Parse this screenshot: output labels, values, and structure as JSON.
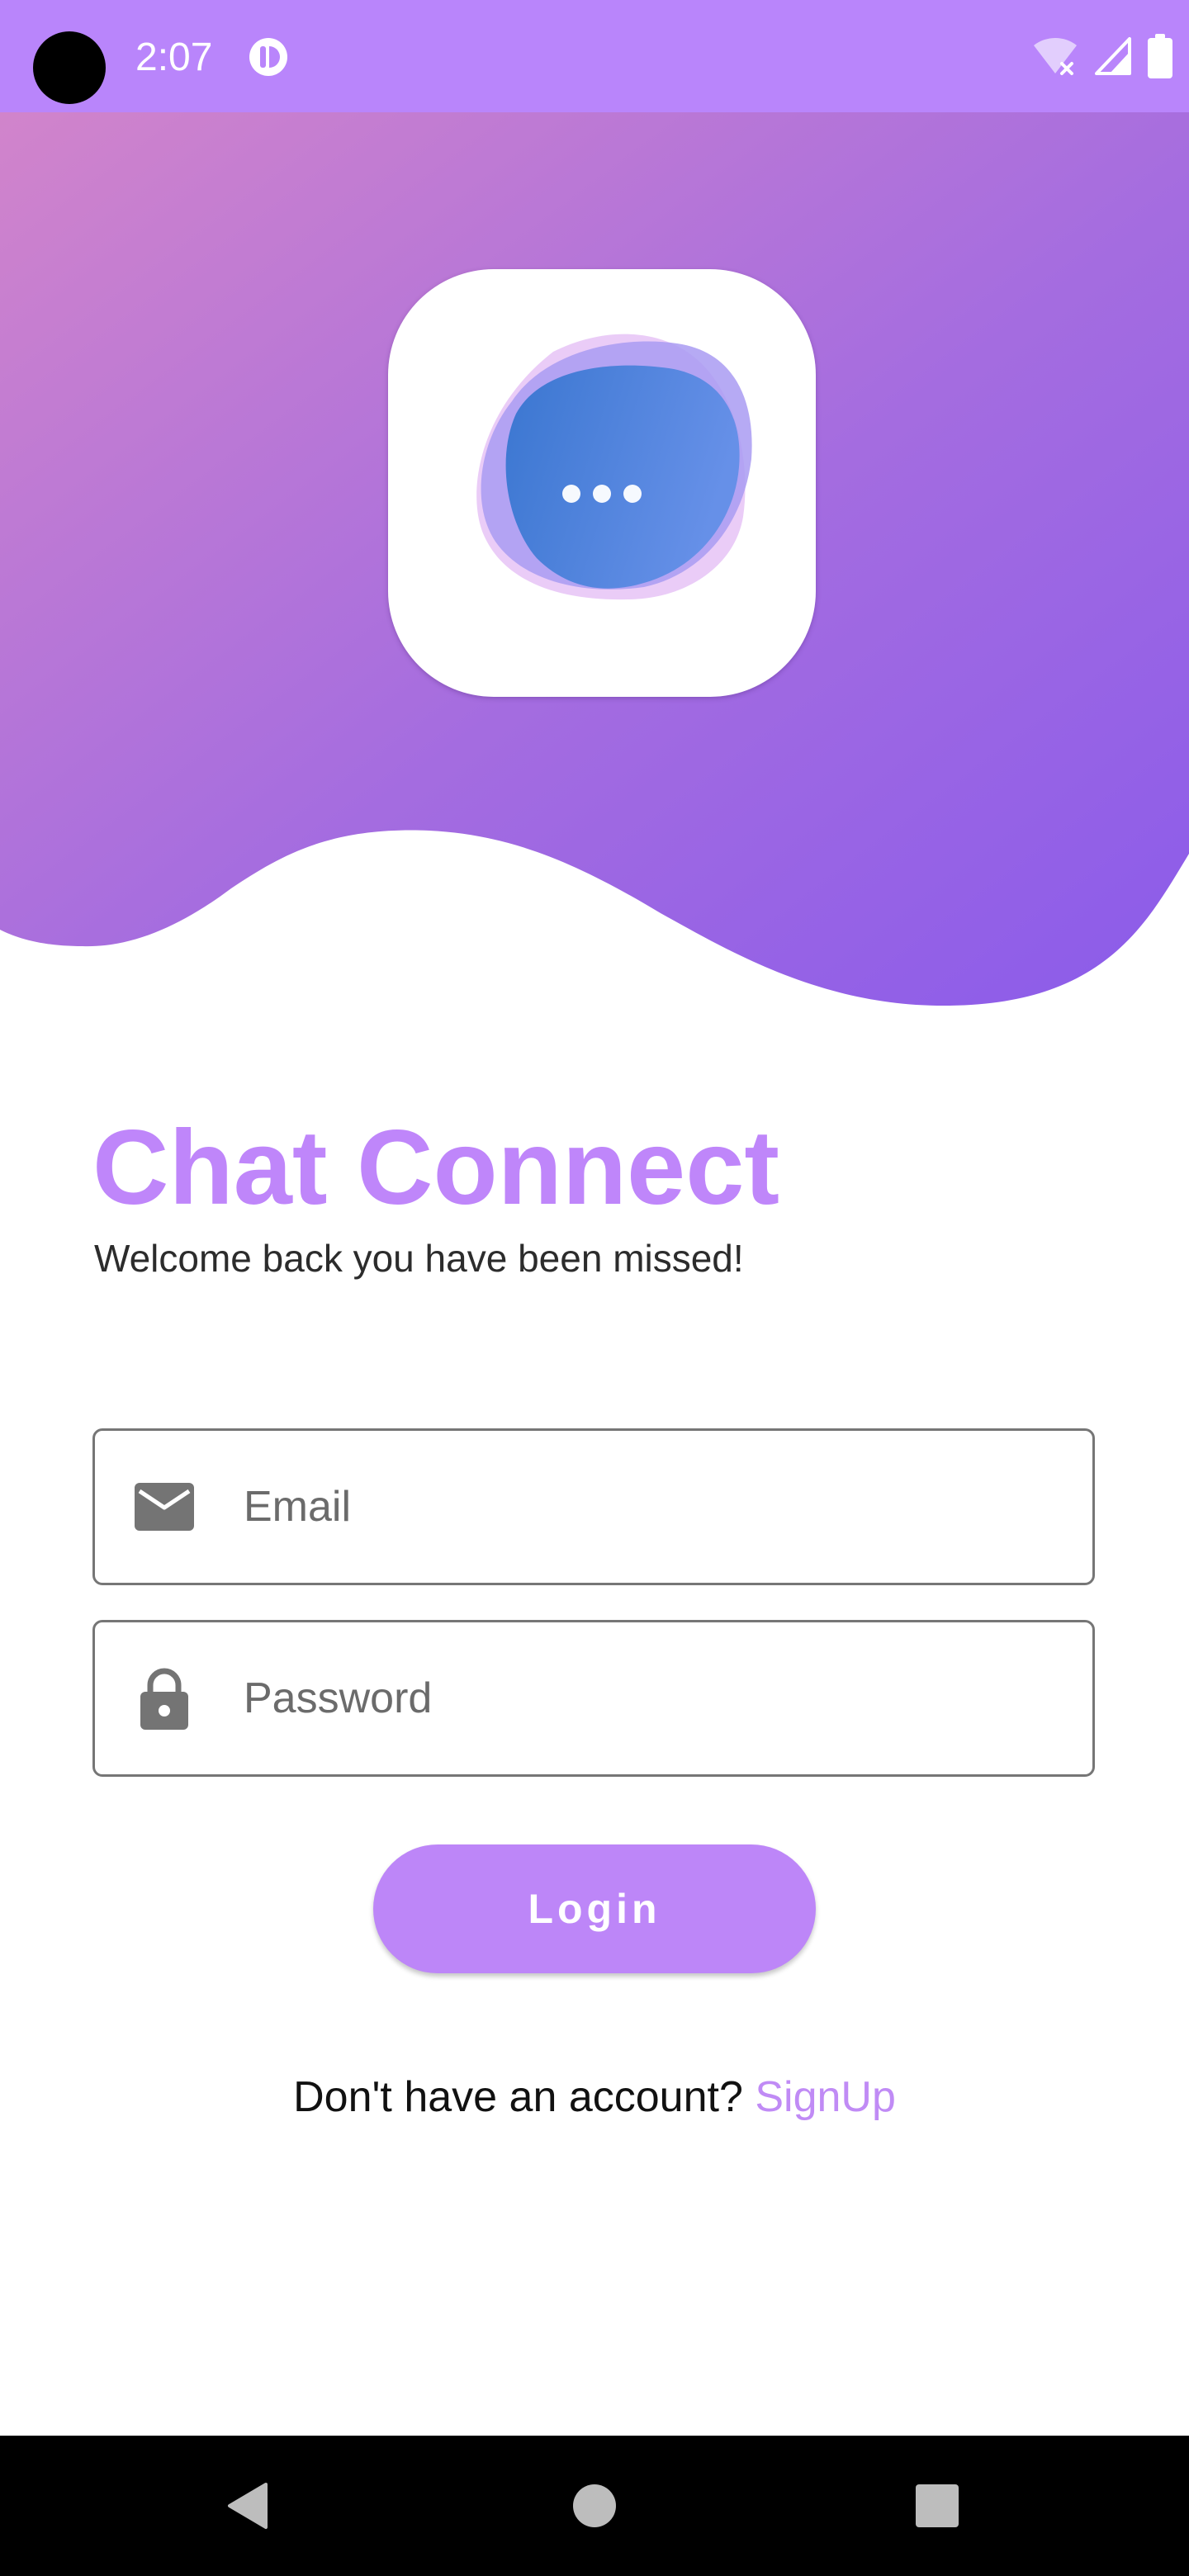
{
  "status_bar": {
    "time": "2:07",
    "app_icon": "notification-app-icon",
    "wifi_icon": "wifi-off-icon",
    "signal_icon": "cell-signal-icon",
    "battery_icon": "battery-full-icon"
  },
  "header": {
    "gradient_start": "#d184cb",
    "gradient_end": "#8c5cea",
    "logo_icon": "chat-bubble-logo-icon"
  },
  "main": {
    "title": "Chat Connect",
    "subtitle": "Welcome back you have been missed!"
  },
  "form": {
    "email": {
      "placeholder": "Email",
      "value": "",
      "icon": "email-icon"
    },
    "password": {
      "placeholder": "Password",
      "value": "",
      "icon": "lock-icon"
    },
    "login_label": "Login"
  },
  "footer": {
    "question": "Don't have an account?",
    "signup_label": "SignUp"
  },
  "nav_bar": {
    "back_icon": "back-triangle-icon",
    "home_icon": "home-circle-icon",
    "recents_icon": "recents-square-icon"
  },
  "colors": {
    "accent": "#bf86fa",
    "status_bar": "#b985fb",
    "link": "#c08bf5"
  }
}
